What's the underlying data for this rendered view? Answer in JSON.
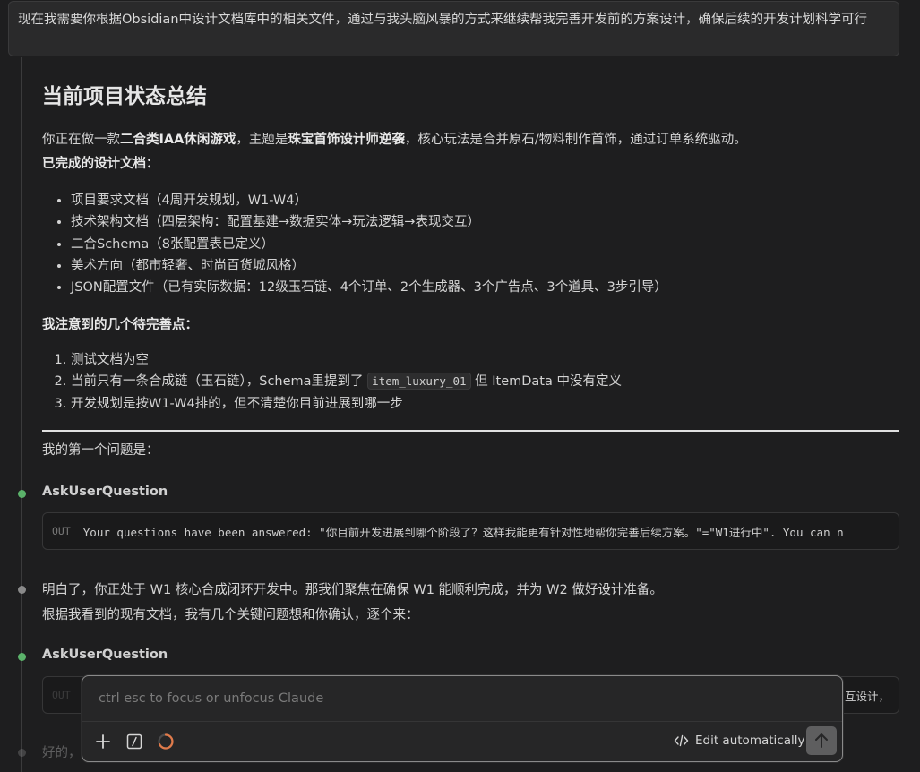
{
  "user_message": "现在我需要你根据Obsidian中设计文档库中的相关文件，通过与我头脑风暴的方式来继续帮我完善开发前的方案设计，确保后续的开发计划科学可行",
  "response": {
    "heading": "当前项目状态总结",
    "intro_1": "你正在做一款",
    "intro_bold_1": "二合类IAA休闲游戏",
    "intro_2": "，主题是",
    "intro_bold_2": "珠宝首饰设计师逆袭",
    "intro_3": "，核心玩法是合并原石/物料制作首饰，通过订单系统驱动。",
    "done_title": "已完成的设计文档：",
    "done_items": [
      "项目要求文档（4周开发规划，W1-W4）",
      "技术架构文档（四层架构：配置基建→数据实体→玩法逻辑→表现交互）",
      "二合Schema（8张配置表已定义）",
      "美术方向（都市轻奢、时尚百货城风格）",
      "JSON配置文件（已有实际数据：12级玉石链、4个订单、2个生成器、3个广告点、3个道具、3步引导）"
    ],
    "todo_title": "我注意到的几个待完善点：",
    "todo_1": "测试文档为空",
    "todo_2_a": "当前只有一条合成链（玉石链），Schema里提到了 ",
    "todo_2_code": "item_luxury_01",
    "todo_2_b": " 但 ItemData 中没有定义",
    "todo_3": "开发规划是按W1-W4排的，但不清楚你目前进展到哪一步",
    "first_question": "我的第一个问题是："
  },
  "tool_1": {
    "name": "AskUserQuestion",
    "out_label": "OUT",
    "out_text": "Your questions have been answered: \"你目前开发进展到哪个阶段了？这样我能更有针对性地帮你完善后续方案。\"=\"W1进行中\". You can n"
  },
  "reply_2": {
    "line_1": "明白了，你正处于 W1 核心合成闭环开发中。那我们聚焦在确保 W1 能顺利完成，并为 W2 做好设计准备。",
    "line_2": "根据我看到的现有文档，我有几个关键问题想和你确认，逐个来："
  },
  "tool_2": {
    "name": "AskUserQuestion",
    "out_label": "OUT",
    "out_tail": "互设计，"
  },
  "faded_text": "好的，",
  "composer": {
    "placeholder": "ctrl esc to focus or unfocus Claude",
    "edit_label": "Edit automatically"
  },
  "icons": {
    "add": "plus-icon",
    "slash": "slash-command-icon",
    "progress": "progress-ring-icon",
    "code": "code-icon",
    "send": "arrow-up-icon"
  },
  "colors": {
    "background": "#1e1e1f",
    "dot_green": "#5bb26a",
    "dot_gray": "#8a8a8a",
    "progress_orange": "#e07a4a"
  }
}
